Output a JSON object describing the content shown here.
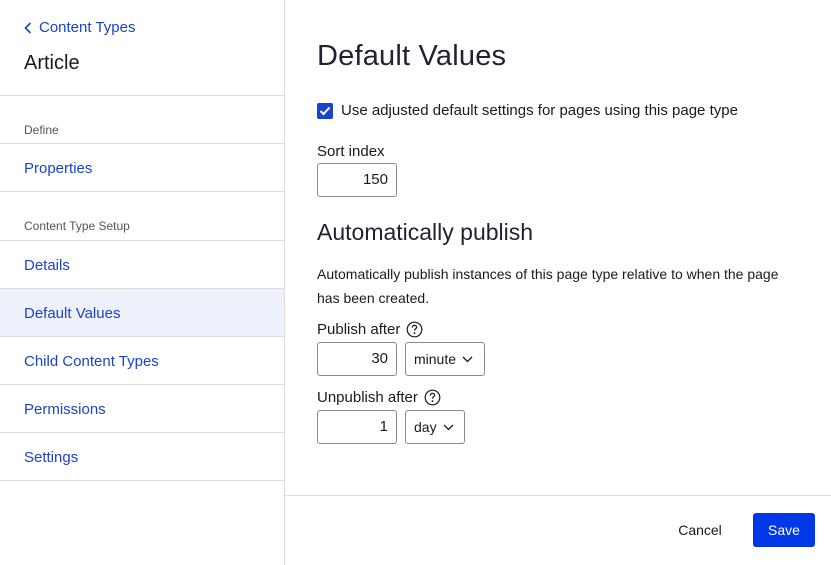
{
  "sidebar": {
    "back_label": "Content Types",
    "title": "Article",
    "sections": [
      {
        "label": "Define",
        "items": [
          {
            "label": "Properties"
          }
        ]
      },
      {
        "label": "Content Type Setup",
        "items": [
          {
            "label": "Details"
          },
          {
            "label": "Default Values",
            "active": true
          },
          {
            "label": "Child Content Types"
          },
          {
            "label": "Permissions"
          },
          {
            "label": "Settings"
          }
        ]
      }
    ]
  },
  "main": {
    "title": "Default Values",
    "use_adjusted_label": "Use adjusted default settings for pages using this page type",
    "use_adjusted_checked": true,
    "sort_index": {
      "label": "Sort index",
      "value": "150"
    },
    "auto_publish": {
      "title": "Automatically publish",
      "description": "Automatically publish instances of this page type relative to when the page has been created.",
      "publish_after": {
        "label": "Publish after",
        "value": "30",
        "unit": "minute"
      },
      "unpublish_after": {
        "label": "Unpublish after",
        "value": "1",
        "unit": "day"
      }
    }
  },
  "footer": {
    "cancel_label": "Cancel",
    "save_label": "Save"
  },
  "colors": {
    "accent": "#1a44c8",
    "primary_button": "#0037e6",
    "active_nav_bg": "#eef0fb"
  }
}
